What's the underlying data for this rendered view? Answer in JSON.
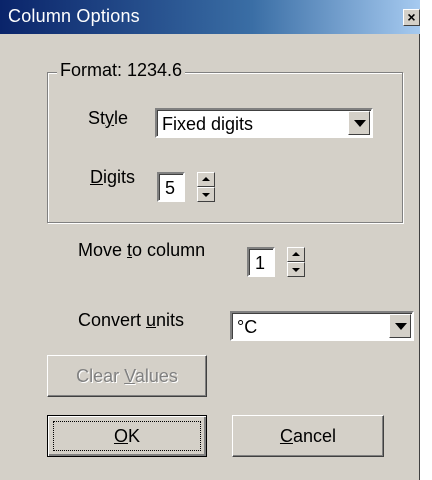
{
  "window": {
    "title": "Column Options",
    "close_glyph": "×"
  },
  "format_group": {
    "legend": "Format: 1234.6",
    "style": {
      "label_pre": "St",
      "label_accel": "y",
      "label_post": "le",
      "value": "Fixed digits"
    },
    "digits": {
      "label_pre": "",
      "label_accel": "D",
      "label_post": "igits",
      "value": "5"
    }
  },
  "move_to_column": {
    "label_pre": "Move ",
    "label_accel": "t",
    "label_post": "o column",
    "value": "1"
  },
  "convert_units": {
    "label_pre": "Convert ",
    "label_accel": "u",
    "label_post": "nits",
    "value": "°C"
  },
  "buttons": {
    "clear_values": {
      "pre": "Clear ",
      "accel": "V",
      "post": "alues",
      "enabled": false
    },
    "ok": {
      "pre": "",
      "accel": "O",
      "post": "K"
    },
    "cancel": {
      "pre": "",
      "accel": "C",
      "post": "ancel"
    }
  },
  "colors": {
    "title_gradient_start": "#0a246a",
    "title_gradient_end": "#a6caf0",
    "face": "#d4d0c8"
  }
}
